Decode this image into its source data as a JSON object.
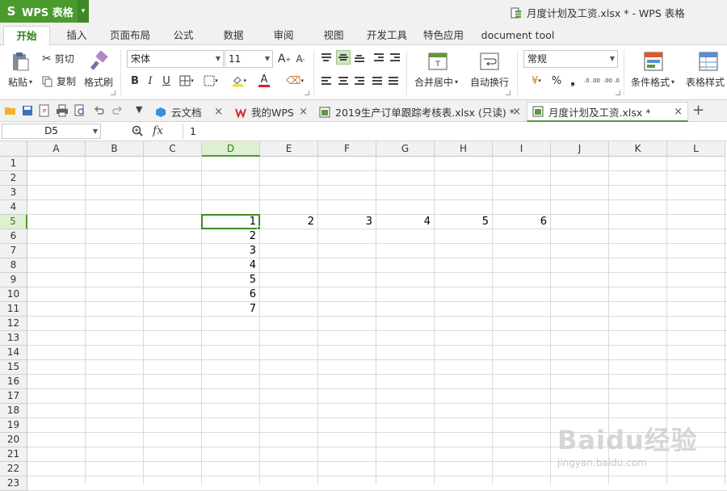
{
  "titlebar": {
    "app_logo": "S",
    "app_name": "WPS 表格",
    "app_caret": "▾",
    "document_title": "月度计划及工资.xlsx * - WPS 表格"
  },
  "ribbon_tabs": [
    "开始",
    "插入",
    "页面布局",
    "公式",
    "数据",
    "审阅",
    "视图",
    "开发工具",
    "特色应用",
    "document tool"
  ],
  "active_ribbon_tab": "开始",
  "toolbar": {
    "paste_label": "粘贴",
    "cut_label": "剪切",
    "copy_label": "复制",
    "format_painter_label": "格式刷",
    "font_name": "宋体",
    "font_size": "11",
    "grow_font": "A",
    "shrink_font": "A",
    "bold": "B",
    "italic": "I",
    "underline": "U",
    "merge_center_label": "合并居中",
    "wrap_text_label": "自动换行",
    "number_format": "常规",
    "percent": "%",
    "thousands": "❟",
    "increase_decimal": ".0 .00",
    "decrease_decimal": ".00 .0",
    "conditional_format_label": "条件格式",
    "table_style_label": "表格样式",
    "font_color": "A"
  },
  "document_tabs": [
    {
      "label": "云文档",
      "icon": "cloud-icon"
    },
    {
      "label": "我的WPS",
      "icon": "wps-logo-icon"
    },
    {
      "label": "2019生产订单跟踪考核表.xlsx (只读) *",
      "icon": "spreadsheet-icon"
    },
    {
      "label": "月度计划及工资.xlsx *",
      "icon": "spreadsheet-icon",
      "active": true
    }
  ],
  "tab_close": "×",
  "new_tab": "+",
  "formula_bar": {
    "name_box": "D5",
    "fx": "fx",
    "formula": "1"
  },
  "columns": [
    "A",
    "B",
    "C",
    "D",
    "E",
    "F",
    "G",
    "H",
    "I",
    "J",
    "K",
    "L"
  ],
  "rows": [
    "1",
    "2",
    "3",
    "4",
    "5",
    "6",
    "7",
    "8",
    "9",
    "10",
    "11",
    "12",
    "13",
    "14",
    "15",
    "16",
    "17",
    "18",
    "19",
    "20",
    "21",
    "22",
    "23"
  ],
  "selected_column": "D",
  "selected_row": "5",
  "cells": [
    {
      "ref": "D5",
      "value": "1"
    },
    {
      "ref": "E5",
      "value": "2"
    },
    {
      "ref": "F5",
      "value": "3"
    },
    {
      "ref": "G5",
      "value": "4"
    },
    {
      "ref": "H5",
      "value": "5"
    },
    {
      "ref": "I5",
      "value": "6"
    },
    {
      "ref": "D6",
      "value": "2"
    },
    {
      "ref": "D7",
      "value": "3"
    },
    {
      "ref": "D8",
      "value": "4"
    },
    {
      "ref": "D9",
      "value": "5"
    },
    {
      "ref": "D10",
      "value": "6"
    },
    {
      "ref": "D11",
      "value": "7"
    }
  ],
  "watermark": {
    "logo": "Baidu经验",
    "url": "jingyan.baidu.com"
  },
  "colors": {
    "accent": "#4a9a2e",
    "selection_border": "#3d8c23",
    "header_bg": "#f1f1f1"
  }
}
